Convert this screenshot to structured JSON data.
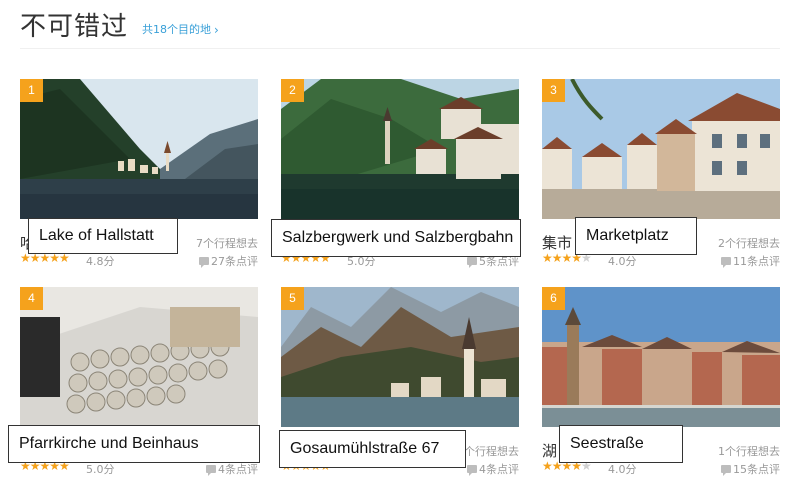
{
  "header": {
    "title": "不可错过",
    "dest_link": "共18个目的地",
    "chevron": "›"
  },
  "icons": {
    "rank_badge": "rank-badge",
    "review_icon": "comment-icon",
    "chevron": "chevron-right-icon"
  },
  "colors": {
    "accent": "#f5a21c",
    "link": "#3aa0d8"
  },
  "cards": [
    {
      "rank": "1",
      "name": "哈",
      "itineraries": "7个行程想去",
      "stars": 5,
      "score": "4.8分",
      "reviews": "27条点评",
      "overlay": "Lake of Hallstatt"
    },
    {
      "rank": "2",
      "name": "",
      "itineraries": "",
      "stars": 5,
      "score": "5.0分",
      "reviews": "5条点评",
      "overlay": "Salzbergwerk und Salzbergbahn"
    },
    {
      "rank": "3",
      "name": "集市",
      "itineraries": "2个行程想去",
      "stars": 4,
      "score": "4.0分",
      "reviews": "11条点评",
      "overlay": "Marketplatz"
    },
    {
      "rank": "4",
      "name": "",
      "itineraries": "",
      "stars": 5,
      "score": "5.0分",
      "reviews": "4条点评",
      "overlay": "Pfarrkirche und Beinhaus"
    },
    {
      "rank": "5",
      "name": "",
      "itineraries": "个行程想去",
      "stars": 5,
      "score": "",
      "reviews": "4条点评",
      "overlay": "Gosaumühlstraße 67"
    },
    {
      "rank": "6",
      "name": "湖",
      "itineraries": "1个行程想去",
      "stars": 4,
      "score": "4.0分",
      "reviews": "15条点评",
      "overlay": "Seestraße"
    }
  ]
}
